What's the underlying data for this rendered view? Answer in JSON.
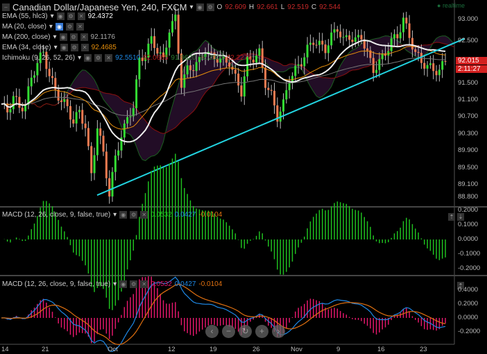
{
  "header": {
    "symbol_title": "Canadian Dollar/Japanese Yen, 240, FXCM",
    "ohlc": {
      "o_label": "O",
      "o": "92.609",
      "h_label": "H",
      "h": "92.661",
      "l_label": "L",
      "l": "92.519",
      "c_label": "C",
      "c": "92.544"
    },
    "realtime": "realtime"
  },
  "indicators": [
    {
      "name": "EMA (55, hlc3)",
      "value": "92.4372",
      "color": "#ffffff"
    },
    {
      "name": "MA (20, close)",
      "value": "",
      "color": "#ffffff"
    },
    {
      "name": "MA (200, close)",
      "value": "92.1176",
      "color": "#aaaaaa"
    },
    {
      "name": "EMA (34, close)",
      "value": "92.4685",
      "color": "#e8900c"
    },
    {
      "name": "Ichimoku (9, 26, 52, 26)",
      "values": [
        "92.5510",
        "92.0665",
        "91.9620",
        "92.2500",
        "92.2270"
      ],
      "value_colors": [
        "#1e88e5",
        "#b71c1c",
        "#2e7d32",
        "#2e7d32",
        "#b71c1c"
      ]
    }
  ],
  "price_axis": {
    "ticks": [
      "93.000",
      "92.500",
      "91.500",
      "91.100",
      "90.700",
      "90.300",
      "89.900",
      "89.500",
      "89.100",
      "88.800"
    ],
    "last_price": "92.015",
    "countdown": "2:11:27"
  },
  "time_axis": {
    "labels": [
      "14",
      "21",
      "Oct",
      "12",
      "19",
      "26",
      "Nov",
      "9",
      "16",
      "23"
    ]
  },
  "macd1": {
    "name": "MACD (12, 26, close, 9, false, true)",
    "values": [
      "0.0532",
      "0.0427",
      "-0.0104"
    ],
    "ticks": [
      "0.2000",
      "0.1000",
      "0.0000",
      "-0.1000",
      "-0.2000"
    ]
  },
  "macd2": {
    "name": "MACD (12, 26, close, 9, false, true)",
    "values": [
      "0.0532",
      "0.0427",
      "-0.0104"
    ],
    "ticks": [
      "0.4000",
      "0.2000",
      "0.0000",
      "-0.2000"
    ]
  },
  "nav": [
    "‹",
    "−",
    "↻",
    "+",
    "›"
  ],
  "colors": {
    "up": "#33dd33",
    "down": "#f47a50",
    "trend": "#22d3e0",
    "macd_hist1": "#1fbf1f",
    "macd_hist2": "#e0176a",
    "macd_line": "#1e88e5",
    "signal_line": "#e07010"
  },
  "chart_data": {
    "type": "candlestick",
    "title": "Canadian Dollar/Japanese Yen, 240, FXCM",
    "ylim": [
      88.7,
      93.3
    ],
    "closes": [
      91.0,
      90.8,
      91.2,
      90.9,
      91.0,
      91.6,
      92.0,
      92.2,
      91.7,
      91.3,
      91.1,
      90.9,
      90.6,
      90.8,
      90.5,
      89.3,
      90.5,
      89.8,
      88.9,
      89.7,
      90.3,
      90.6,
      91.0,
      92.0,
      92.2,
      92.5,
      92.3,
      92.0,
      92.8,
      93.0,
      91.5,
      91.8,
      91.9,
      92.0,
      92.3,
      92.1,
      92.1,
      92.0,
      92.0,
      91.6,
      91.3,
      92.0,
      92.1,
      92.2,
      91.5,
      91.2,
      90.7,
      91.0,
      91.6,
      91.8,
      92.0,
      92.3,
      92.5,
      92.4,
      92.3,
      92.6,
      92.8,
      92.5,
      92.6,
      92.5,
      92.6,
      92.2,
      91.8,
      92.0,
      92.2,
      92.5,
      92.6,
      93.0,
      92.6,
      92.2,
      92.0,
      91.9,
      91.8,
      91.8,
      92.0
    ],
    "trendline": [
      [
        88.85,
        140
      ],
      [
        92.55,
        670
      ]
    ]
  }
}
